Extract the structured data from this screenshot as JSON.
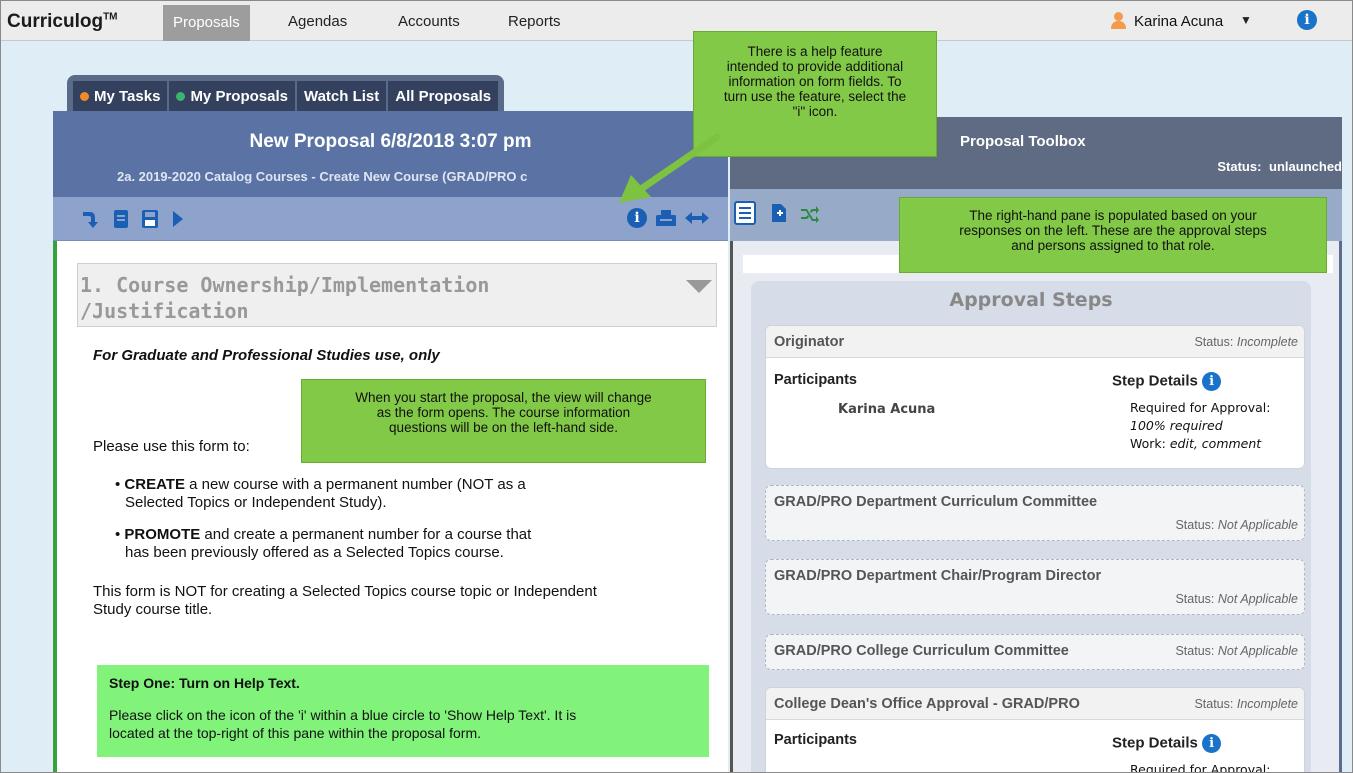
{
  "app": {
    "logo": "Curriculog",
    "logo_tm": "TM",
    "nav": [
      "Proposals",
      "Agendas",
      "Accounts",
      "Reports"
    ],
    "user": "Karina Acuna"
  },
  "tabs": [
    "My Tasks",
    "My Proposals",
    "Watch List",
    "All Proposals"
  ],
  "colors": {
    "tab_dot_tasks": "#f08a2a",
    "tab_dot_proposals": "#3cb371",
    "accent": "#1a73c9",
    "green": "#36a23d"
  },
  "left": {
    "title": "New Proposal 6/8/2018 3:07 pm",
    "subtitle": "2a. 2019-2020 Catalog Courses - Create New Course (GRAD/PRO c",
    "section_title_1": "1. Course Ownership/Implementation",
    "section_title_2": "/Justification",
    "gps_only": "For Graduate and Professional Studies use, only",
    "use_form": "Please use this form to:",
    "bullet1_bold": "CREATE",
    "bullet1_line1": " a new course with a permanent number (NOT as a",
    "bullet1_line2": "Selected Topics or Independent Study).",
    "bullet2_bold": "PROMOTE",
    "bullet2_line1": " and create a permanent number for a course that",
    "bullet2_line2": "has been previously offered as a Selected Topics course.",
    "not_for_1": "This form is NOT for creating a Selected Topics course topic or Independent",
    "not_for_2": "Study course title.",
    "step_title": "Step One: Turn on Help Text.",
    "step_text_1": "Please click on the icon of the 'i' within a blue circle to 'Show Help Text'. It is",
    "step_text_2": "located at the top-right of this pane within the proposal form."
  },
  "callouts": {
    "help_1": "There is a help feature",
    "help_2": "intended to provide additional",
    "help_3": "information on form fields. To",
    "help_4": "turn use the feature, select the",
    "help_5": "\"i\" icon.",
    "start_1": "When you start the proposal, the view will change",
    "start_2": "as the form opens. The course information",
    "start_3": "questions will be on the left-hand side.",
    "right_1": "The right-hand pane is populated based on your",
    "right_2": "responses on the left. These are the approval steps",
    "right_3": "and persons assigned to that role."
  },
  "right": {
    "title": "Proposal Toolbox",
    "status_label": "Status:",
    "status_value": "unlaunched",
    "steps_title": "Approval Steps",
    "steps": [
      {
        "name": "Originator",
        "status_label": "Status:",
        "status": "Incomplete"
      },
      {
        "name": "GRAD/PRO Department Curriculum Committee",
        "status_label": "Status:",
        "status": "Not Applicable"
      },
      {
        "name": "GRAD/PRO Department Chair/Program Director",
        "status_label": "Status:",
        "status": "Not Applicable"
      },
      {
        "name": "GRAD/PRO College Curriculum Committee",
        "status_label": "Status:",
        "status": "Not Applicable"
      },
      {
        "name": "College Dean's Office Approval - GRAD/PRO",
        "status_label": "Status:",
        "status": "Incomplete"
      }
    ],
    "participants_label": "Participants",
    "step_details_label": "Step Details",
    "participant": "Karina Acuna",
    "required_label": "Required for Approval:",
    "required_value": "100% required",
    "work_label": "Work:",
    "work_value": "edit, comment",
    "required_cut": "Required for Approval:"
  }
}
